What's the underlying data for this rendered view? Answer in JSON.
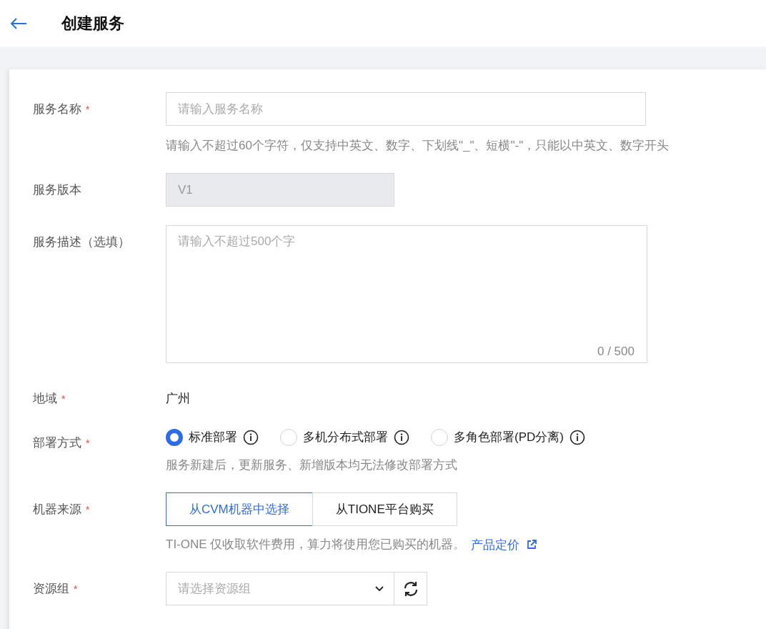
{
  "header": {
    "title": "创建服务"
  },
  "form": {
    "fields": [
      {
        "kind": "text",
        "label": "服务名称",
        "required_mark": "*",
        "placeholder": "请输入服务名称",
        "help": "请输入不超过60个字符，仅支持中英文、数字、下划线\"_\"、短横\"-\"，只能以中英文、数字开头"
      },
      {
        "kind": "text",
        "label": "服务版本",
        "disabled": true,
        "value": "V1"
      },
      {
        "kind": "textarea",
        "label": "服务描述（选填）",
        "placeholder": "请输入不超过500个字",
        "counter": "0 / 500"
      },
      {
        "kind": "static",
        "label": "地域",
        "required_mark": "*",
        "value": "广州"
      },
      {
        "kind": "radio",
        "label": "部署方式",
        "required_mark": "*",
        "options": [
          {
            "label": "标准部署",
            "selected": true
          },
          {
            "label": "多机分布式部署",
            "selected": false
          },
          {
            "label": "多角色部署(PD分离)",
            "selected": false
          }
        ],
        "help": "服务新建后，更新服务、新增版本均无法修改部署方式"
      },
      {
        "kind": "segmented",
        "label": "机器来源",
        "required_mark": "*",
        "options": [
          {
            "label": "从CVM机器中选择",
            "selected": true
          },
          {
            "label": "从TIONE平台购买",
            "selected": false
          }
        ],
        "help": "TI-ONE 仅收取软件费用，算力将使用您已购买的机器。",
        "link": "产品定价"
      },
      {
        "kind": "select",
        "label": "资源组",
        "required_mark": "*",
        "placeholder": "请选择资源组"
      }
    ]
  }
}
